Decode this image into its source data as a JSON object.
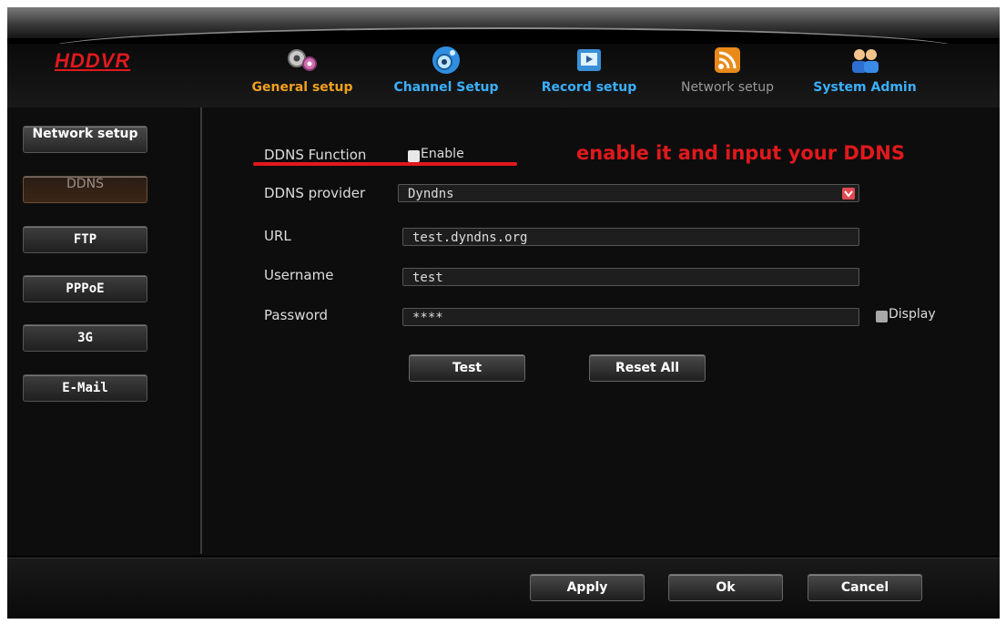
{
  "app": {
    "logo": "HDDVR"
  },
  "nav": {
    "tabs": [
      {
        "label": "General setup",
        "icon": "gears-icon",
        "color": "#f0a020"
      },
      {
        "label": "Channel Setup",
        "icon": "camera-icon",
        "color": "#3ab0ff"
      },
      {
        "label": "Record setup",
        "icon": "film-icon",
        "color": "#3ab0ff"
      },
      {
        "label": "Network setup",
        "icon": "wifi-icon",
        "color": "#9a9a9a"
      },
      {
        "label": "System Admin",
        "icon": "users-icon",
        "color": "#3ab0ff"
      }
    ]
  },
  "sidebar": {
    "items": [
      {
        "label": "Network setup"
      },
      {
        "label": "DDNS"
      },
      {
        "label": "FTP"
      },
      {
        "label": "PPPoE"
      },
      {
        "label": "3G"
      },
      {
        "label": "E-Mail"
      }
    ]
  },
  "form": {
    "ddns_function": {
      "label": "DDNS Function",
      "checkbox_label": "Enable"
    },
    "provider": {
      "label": "DDNS provider",
      "value": "Dyndns"
    },
    "url": {
      "label": "URL",
      "value": "test.dyndns.org"
    },
    "username": {
      "label": "Username",
      "value": "test"
    },
    "password": {
      "label": "Password",
      "value": "****",
      "display_label": "Display"
    },
    "test_label": "Test",
    "reset_label": "Reset All"
  },
  "annotation": {
    "text": "enable it and input your DDNS",
    "color": "#e0191d"
  },
  "footer": {
    "apply_label": "Apply",
    "ok_label": "Ok",
    "cancel_label": "Cancel"
  }
}
